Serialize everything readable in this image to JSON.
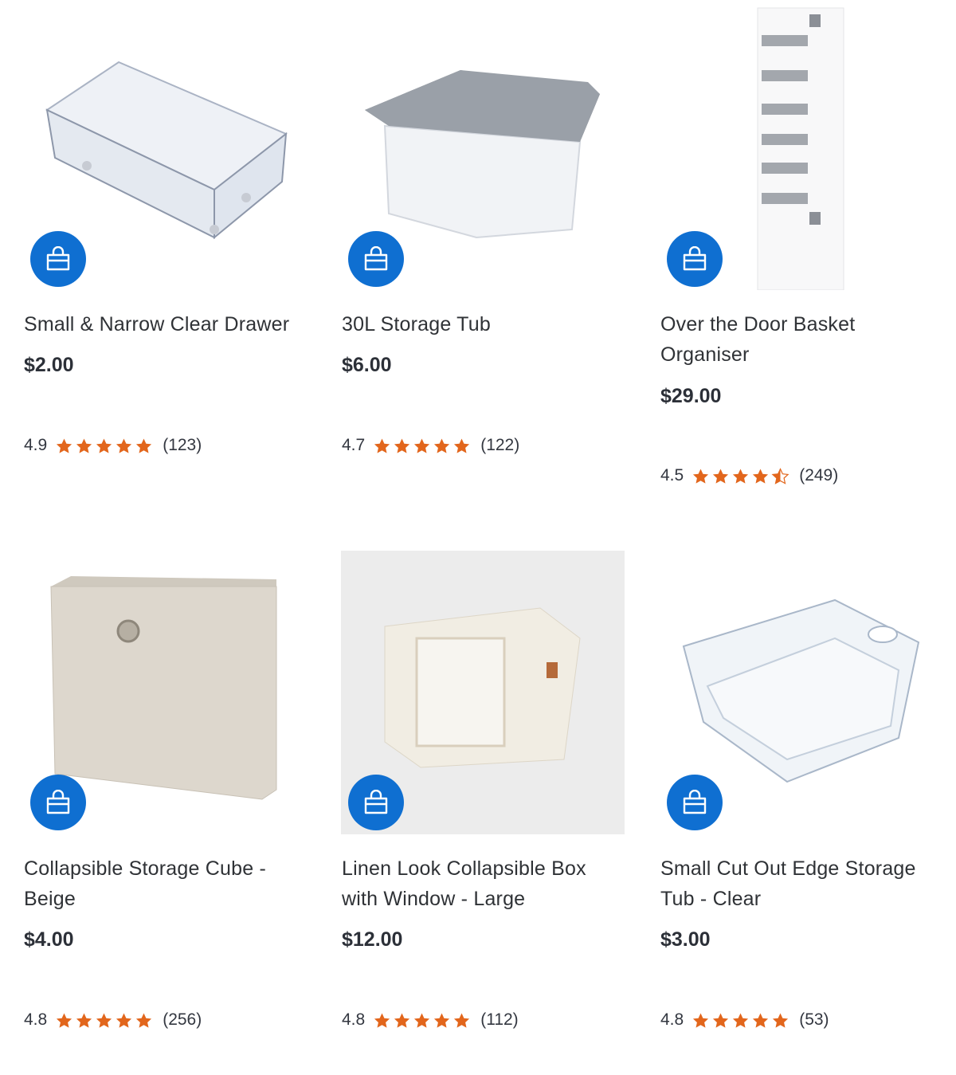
{
  "products": [
    {
      "name": "Small & Narrow Clear Drawer",
      "price": "$2.00",
      "rating": "4.9",
      "stars": 5,
      "reviews": "(123)"
    },
    {
      "name": "30L Storage Tub",
      "price": "$6.00",
      "rating": "4.7",
      "stars": 5,
      "reviews": "(122)"
    },
    {
      "name": "Over the Door Basket Organiser",
      "price": "$29.00",
      "rating": "4.5",
      "stars": 4.5,
      "reviews": "(249)"
    },
    {
      "name": "Collapsible Storage Cube - Beige",
      "price": "$4.00",
      "rating": "4.8",
      "stars": 5,
      "reviews": "(256)"
    },
    {
      "name": "Linen Look Collapsible Box with Window - Large",
      "price": "$12.00",
      "rating": "4.8",
      "stars": 5,
      "reviews": "(112)"
    },
    {
      "name": "Small Cut Out Edge Storage Tub - Clear",
      "price": "$3.00",
      "rating": "4.8",
      "stars": 5,
      "reviews": "(53)"
    }
  ],
  "icons": {
    "add_to_bag": "shopping-bag-icon",
    "star": "star-icon"
  },
  "colors": {
    "accent": "#0f6fd1",
    "star": "#e2661c",
    "text": "#2f3236"
  }
}
